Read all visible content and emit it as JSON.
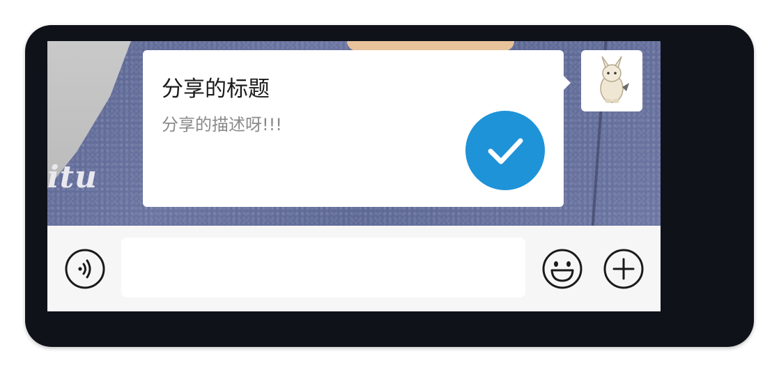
{
  "share_card": {
    "title": "分享的标题",
    "description": "分享的描述呀!!!",
    "check_icon": "check-circle-icon",
    "accent_color": "#1f93d8"
  },
  "background_photo": {
    "overlay_text": "itu"
  },
  "avatar": {
    "icon": "pikachu-sticker-icon"
  },
  "input_bar": {
    "voice_icon": "voice-icon",
    "emoji_icon": "emoji-icon",
    "plus_icon": "plus-circle-icon",
    "message_value": "",
    "message_placeholder": ""
  }
}
